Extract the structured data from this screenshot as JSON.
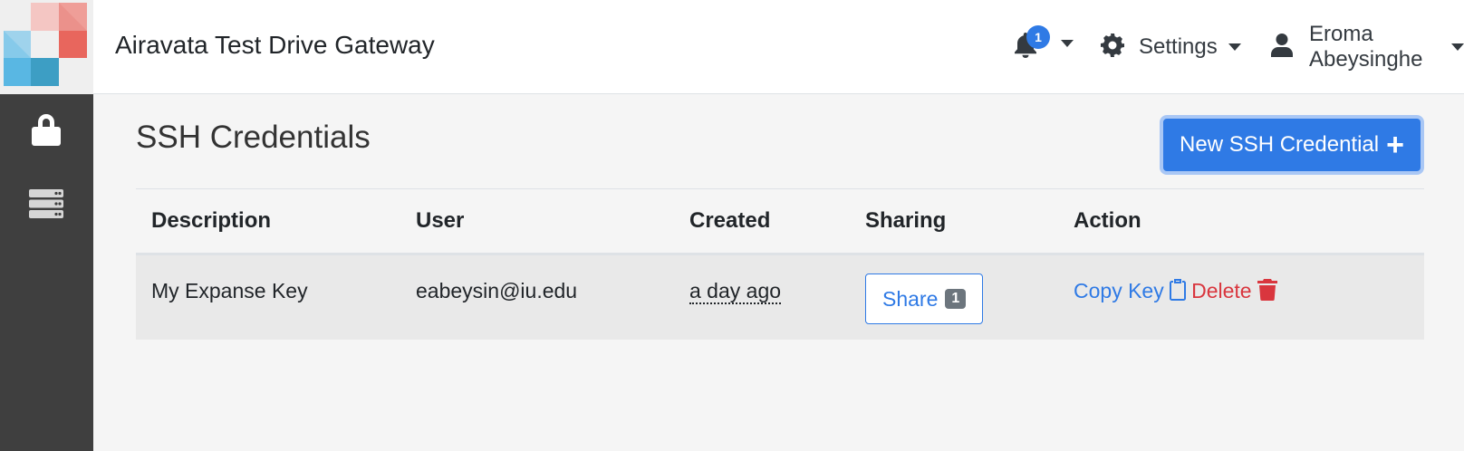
{
  "header": {
    "brand": "Airavata Test Drive Gateway",
    "notifications": {
      "count": "1"
    },
    "settings_label": "Settings",
    "user_label": "Eroma Abeysinghe"
  },
  "sidebar": {
    "items": [
      {
        "icon": "lock-icon"
      },
      {
        "icon": "server-icon"
      }
    ]
  },
  "page": {
    "title": "SSH Credentials",
    "new_button_label": "New SSH Credential"
  },
  "table": {
    "columns": [
      "Description",
      "User",
      "Created",
      "Sharing",
      "Action"
    ],
    "rows": [
      {
        "description": "My Expanse Key",
        "user": "eabeysin@iu.edu",
        "created": "a day ago",
        "share_label": "Share",
        "share_count": "1",
        "copy_label": "Copy Key",
        "delete_label": "Delete"
      }
    ]
  },
  "colors": {
    "accent": "#2f7ae5",
    "danger": "#d9363e",
    "sidebar": "#3f3f3f"
  }
}
